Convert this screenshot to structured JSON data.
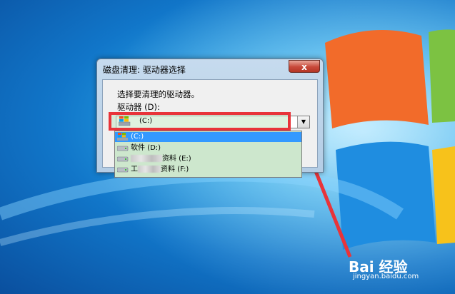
{
  "dialog": {
    "title": "磁盘清理: 驱动器选择",
    "close_symbol": "x",
    "prompt": "选择要清理的驱动器。",
    "drives_label": "驱动器 (D):",
    "selected_drive": "(C:)",
    "dropdown_arrow": "▼",
    "options": [
      {
        "label": "(C:)",
        "icon": "windows-drive-icon",
        "selected": true
      },
      {
        "label": "软件 (D:)",
        "icon": "drive-icon",
        "selected": false
      },
      {
        "label": "资料 (E:)",
        "icon": "drive-icon",
        "selected": false
      },
      {
        "label": "资料 (F:)",
        "icon": "drive-icon",
        "selected": false
      }
    ],
    "option_prefix_f": "工"
  },
  "watermark": {
    "logo": "Bai 经验",
    "url": "jingyan.baidu.com"
  },
  "colors": {
    "highlight": "#e8343a",
    "selection": "#3399ff",
    "list_bg": "#cde7cd",
    "desktop": "#1176c9"
  }
}
